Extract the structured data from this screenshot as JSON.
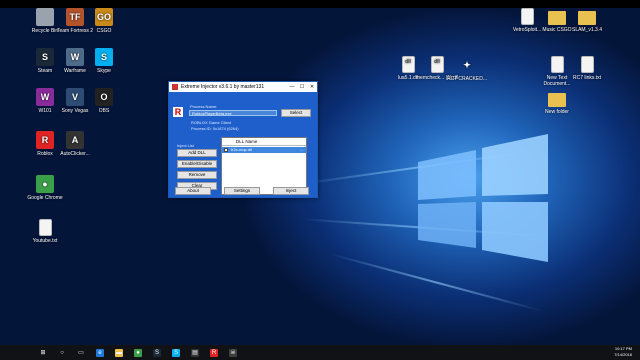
{
  "desktop_left": [
    {
      "label": "Recycle Bin",
      "icon": "recycle-bin-icon",
      "color": "#9aa3ad",
      "glyph": ""
    },
    {
      "label": "Team Fortress 2",
      "icon": "team-fortress-2-icon",
      "color": "#b5532b",
      "glyph": "TF"
    },
    {
      "label": "CSGO",
      "icon": "csgo-icon",
      "color": "#c98a1a",
      "glyph": "GO"
    },
    {
      "label": "Steam",
      "icon": "steam-icon",
      "color": "#1b2838",
      "glyph": "S"
    },
    {
      "label": "Warframe",
      "icon": "warframe-icon",
      "color": "#4f6b8a",
      "glyph": "W"
    },
    {
      "label": "Skype",
      "icon": "skype-icon",
      "color": "#00aff0",
      "glyph": "S"
    },
    {
      "label": "W101",
      "icon": "wizard101-icon",
      "color": "#8a2b9c",
      "glyph": "W"
    },
    {
      "label": "Sony Vegas",
      "icon": "sony-vegas-icon",
      "color": "#2d4b73",
      "glyph": "V"
    },
    {
      "label": "OBS",
      "icon": "obs-icon",
      "color": "#222222",
      "glyph": "O"
    },
    {
      "label": "Roblox",
      "icon": "roblox-icon",
      "color": "#e02424",
      "glyph": "R"
    },
    {
      "label": "AutoClicker...",
      "icon": "autoclicker-icon",
      "color": "#333333",
      "glyph": "A"
    },
    {
      "label": "Google Chrome",
      "icon": "chrome-icon",
      "color": "#3b9f4a",
      "glyph": "●"
    },
    {
      "label": "Youtube.txt",
      "icon": "text-file-icon",
      "color": "#ffffff",
      "glyph": ""
    }
  ],
  "desktop_files": [
    {
      "label": "lua5.1.dll"
    },
    {
      "label": "memcheck... (1).dll"
    },
    {
      "label": "RC7 CRACKED..."
    }
  ],
  "desktop_right": [
    {
      "label": "VetroSploit..."
    },
    {
      "label": "Music CSGO"
    },
    {
      "label": "SLAM_v1.3.4"
    },
    {
      "label": "New Text Document..."
    },
    {
      "label": "RC7 links.txt"
    },
    {
      "label": "New folder"
    }
  ],
  "dialog": {
    "title": "Extreme Injector v3.6.1 by master131",
    "title_buttons": {
      "min": "—",
      "max": "☐",
      "close": "✕"
    },
    "process_label": "Process Name:",
    "process_value": "RobloxPlayerBeta.exe",
    "select_label": "Select",
    "process_info_1": "ROBLOX Game Client",
    "process_info_2": "Process ID: 0x1874 (6264)",
    "inject_list_label": "Inject List",
    "add_dll": "Add DLL",
    "enable_disable": "Enable/Disable",
    "remove": "Remove",
    "clear": "Clear",
    "dll_name_header": "DLL Name",
    "dll_row": "fr2x-mop.dll",
    "dll_row_more": "...",
    "about": "About",
    "settings": "Settings",
    "inject": "Inject"
  },
  "taskbar": {
    "items": [
      {
        "icon": "windows-start-icon",
        "color": "#ffffff",
        "glyph": "⊞"
      },
      {
        "icon": "search-icon",
        "color": "#ffffff",
        "glyph": "○"
      },
      {
        "icon": "task-view-icon",
        "color": "#ffffff",
        "glyph": "▭"
      },
      {
        "icon": "edge-icon",
        "color": "#1e7ad6",
        "glyph": "e"
      },
      {
        "icon": "file-explorer-icon",
        "color": "#e8c150",
        "glyph": "▬"
      },
      {
        "icon": "chrome-taskbar-icon",
        "color": "#3b9f4a",
        "glyph": "●"
      },
      {
        "icon": "steam-taskbar-icon",
        "color": "#1b2838",
        "glyph": "S"
      },
      {
        "icon": "skype-taskbar-icon",
        "color": "#00aff0",
        "glyph": "S"
      },
      {
        "icon": "store-icon",
        "color": "#333333",
        "glyph": "▤"
      },
      {
        "icon": "roblox-taskbar-icon",
        "color": "#e02424",
        "glyph": "R"
      },
      {
        "icon": "injector-taskbar-icon",
        "color": "#3d3d3d",
        "glyph": "☠"
      }
    ],
    "time": "10:17 PM",
    "date": "7/14/2016"
  }
}
